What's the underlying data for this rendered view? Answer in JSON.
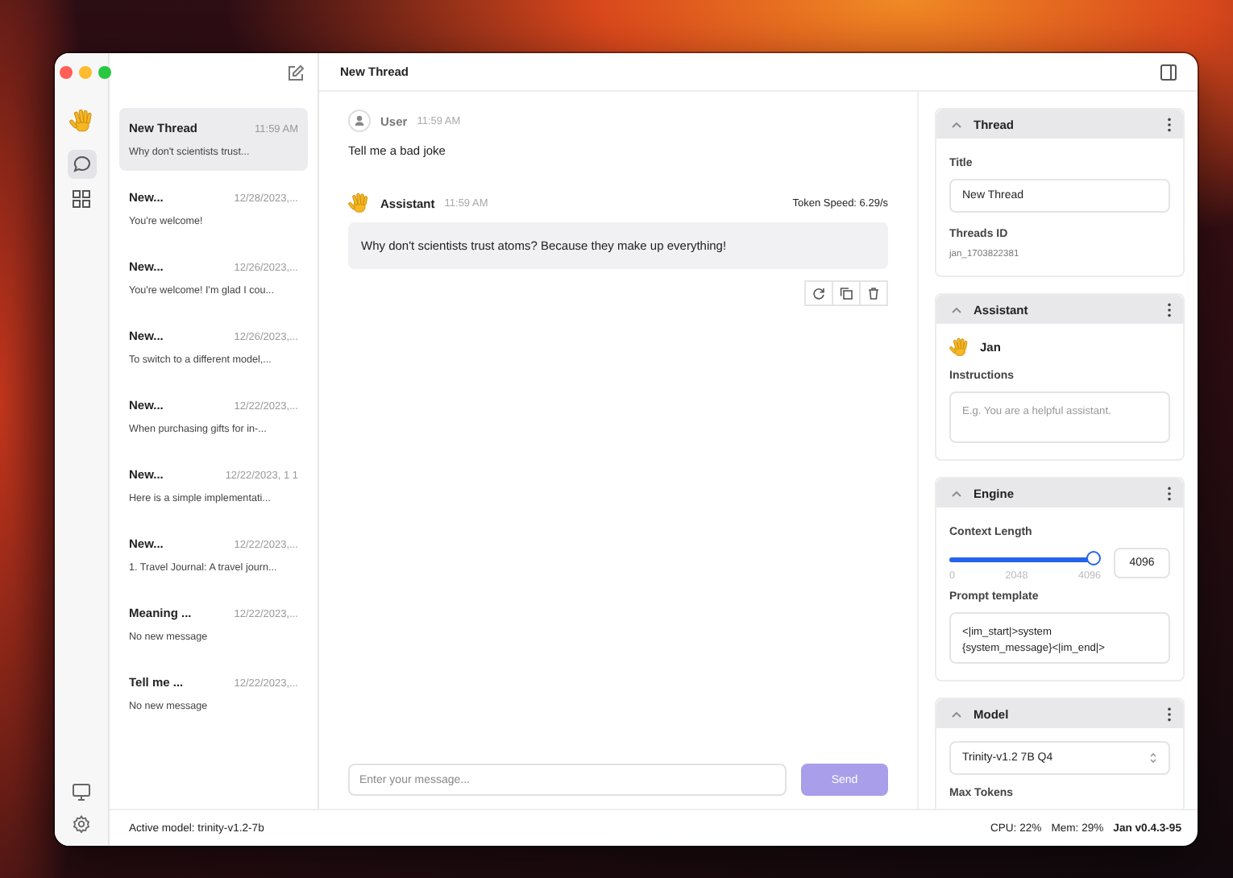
{
  "window": {
    "title": "New Thread"
  },
  "rail": [
    {
      "kind": "chat",
      "selected": true
    },
    {
      "kind": "hub",
      "selected": false
    }
  ],
  "threads": [
    {
      "title": "New Thread",
      "time": "11:59 AM",
      "preview": "Why don't scientists trust...",
      "selected": true
    },
    {
      "title": "New...",
      "time": "12/28/2023,...",
      "preview": "You're welcome!",
      "selected": false
    },
    {
      "title": "New...",
      "time": "12/26/2023,...",
      "preview": "You're welcome! I'm glad I cou...",
      "selected": false
    },
    {
      "title": "New...",
      "time": "12/26/2023,...",
      "preview": "To switch to a different model,...",
      "selected": false
    },
    {
      "title": "New...",
      "time": "12/22/2023,...",
      "preview": "When purchasing gifts for in-...",
      "selected": false
    },
    {
      "title": "New...",
      "time": "12/22/2023, 1 1",
      "preview": "Here is a simple implementati...",
      "selected": false
    },
    {
      "title": "New...",
      "time": "12/22/2023,...",
      "preview": "1. Travel Journal: A travel journ...",
      "selected": false
    },
    {
      "title": "Meaning ...",
      "time": "12/22/2023,...",
      "preview": "No new message",
      "selected": false
    },
    {
      "title": "Tell me ...",
      "time": "12/22/2023,...",
      "preview": "No new message",
      "selected": false
    }
  ],
  "messages": [
    {
      "kind": "user",
      "author": "User",
      "time": "11:59 AM",
      "text": "Tell me a bad joke"
    },
    {
      "kind": "assistant",
      "author": "Assistant",
      "time": "11:59 AM",
      "token_speed": "Token Speed: 6.29/s",
      "text": "Why don't scientists trust atoms? Because they make up everything!"
    }
  ],
  "composer": {
    "placeholder": "Enter your message...",
    "send": {
      "label": "Send",
      "disabled": true
    }
  },
  "panel": {
    "sections": [
      {
        "kind": "thread",
        "title": "Thread",
        "expanded": true,
        "title_label": "Title",
        "title_value": "New Thread",
        "id_label": "Threads ID",
        "id_value": "jan_1703822381"
      },
      {
        "kind": "assistant",
        "title": "Assistant",
        "expanded": true,
        "name": "Jan",
        "instructions_label": "Instructions",
        "instructions_placeholder": "E.g. You are a helpful assistant."
      },
      {
        "kind": "engine",
        "title": "Engine",
        "expanded": true,
        "context_label": "Context Length",
        "level": 1,
        "ticks": [
          "0",
          "2048",
          "4096"
        ],
        "value": "4096",
        "template_label": "Prompt template",
        "template_value": "<|im_start|>system\n{system_message}<|im_end|>"
      },
      {
        "kind": "model",
        "title": "Model",
        "expanded": true,
        "model": "Trinity-v1.2 7B Q4",
        "max_tokens_label": "Max Tokens"
      }
    ]
  },
  "status_bar": {
    "active_model": "Active model: trinity-v1.2-7b",
    "cpu": "CPU: 22%",
    "mem": "Mem: 29%",
    "version": "Jan v0.4.3-95"
  }
}
